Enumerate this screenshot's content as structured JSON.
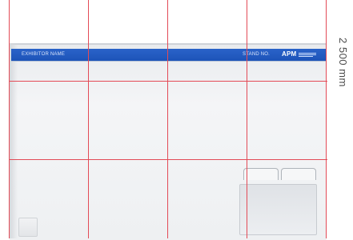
{
  "fascia": {
    "exhibitor_label": "EXHIBITOR NAME",
    "stand_label": "STAND NO.",
    "logo_text": "APM",
    "color": "#1f57bd"
  },
  "dimension": {
    "height_label": "2 500 mm"
  },
  "grid": {
    "columns": 4,
    "rows": 3,
    "line_color": "#e34b57"
  }
}
